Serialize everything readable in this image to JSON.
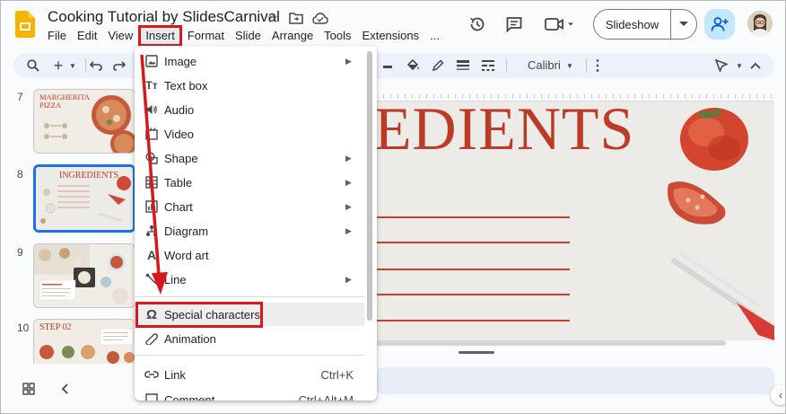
{
  "header": {
    "title": "Cooking Tutorial by SlidesCarnival",
    "title_icons": [
      "star-icon",
      "move-to-folder-icon",
      "cloud-saved-icon"
    ],
    "menu": [
      "File",
      "Edit",
      "View",
      "Insert",
      "Format",
      "Slide",
      "Arrange",
      "Tools",
      "Extensions",
      "..."
    ],
    "active_menu": "Insert",
    "right_icons": [
      "history-icon",
      "comment-icon",
      "video-call-icon"
    ],
    "slideshow_label": "Slideshow"
  },
  "toolbar": {
    "font": "Calibri"
  },
  "filmstrip": {
    "slides": [
      {
        "number": "7",
        "title": "MARGHERITA PIZZA"
      },
      {
        "number": "8",
        "title": "INGREDIENTS",
        "selected": true
      },
      {
        "number": "9",
        "title": ""
      },
      {
        "number": "10",
        "title": "STEP 02"
      }
    ]
  },
  "canvas": {
    "heading": "EDIENTS"
  },
  "insert_menu": {
    "items": [
      {
        "label": "Image",
        "icon": "image-icon",
        "submenu": true
      },
      {
        "label": "Text box",
        "icon": "text-box-icon",
        "submenu": false
      },
      {
        "label": "Audio",
        "icon": "audio-icon",
        "submenu": false
      },
      {
        "label": "Video",
        "icon": "video-icon",
        "submenu": false
      },
      {
        "label": "Shape",
        "icon": "shape-icon",
        "submenu": true
      },
      {
        "label": "Table",
        "icon": "table-icon",
        "submenu": true
      },
      {
        "label": "Chart",
        "icon": "chart-icon",
        "submenu": true
      },
      {
        "label": "Diagram",
        "icon": "diagram-icon",
        "submenu": true
      },
      {
        "label": "Word art",
        "icon": "word-art-icon",
        "submenu": false
      },
      {
        "label": "Line",
        "icon": "line-icon",
        "submenu": true
      },
      {
        "label": "Special characters",
        "icon": "omega-icon",
        "submenu": false,
        "highlighted": true
      },
      {
        "label": "Animation",
        "icon": "animation-icon",
        "submenu": false
      },
      {
        "label": "Link",
        "icon": "link-icon",
        "submenu": false,
        "shortcut": "Ctrl+K"
      },
      {
        "label": "Comment",
        "icon": "comment-add-icon",
        "submenu": false,
        "shortcut": "Ctrl+Alt+M"
      }
    ]
  },
  "colors": {
    "accent": "#1a73e8",
    "highlight_red": "#d7191c",
    "slide_red": "#bd3b25",
    "share_bg": "#c2e7ff"
  }
}
